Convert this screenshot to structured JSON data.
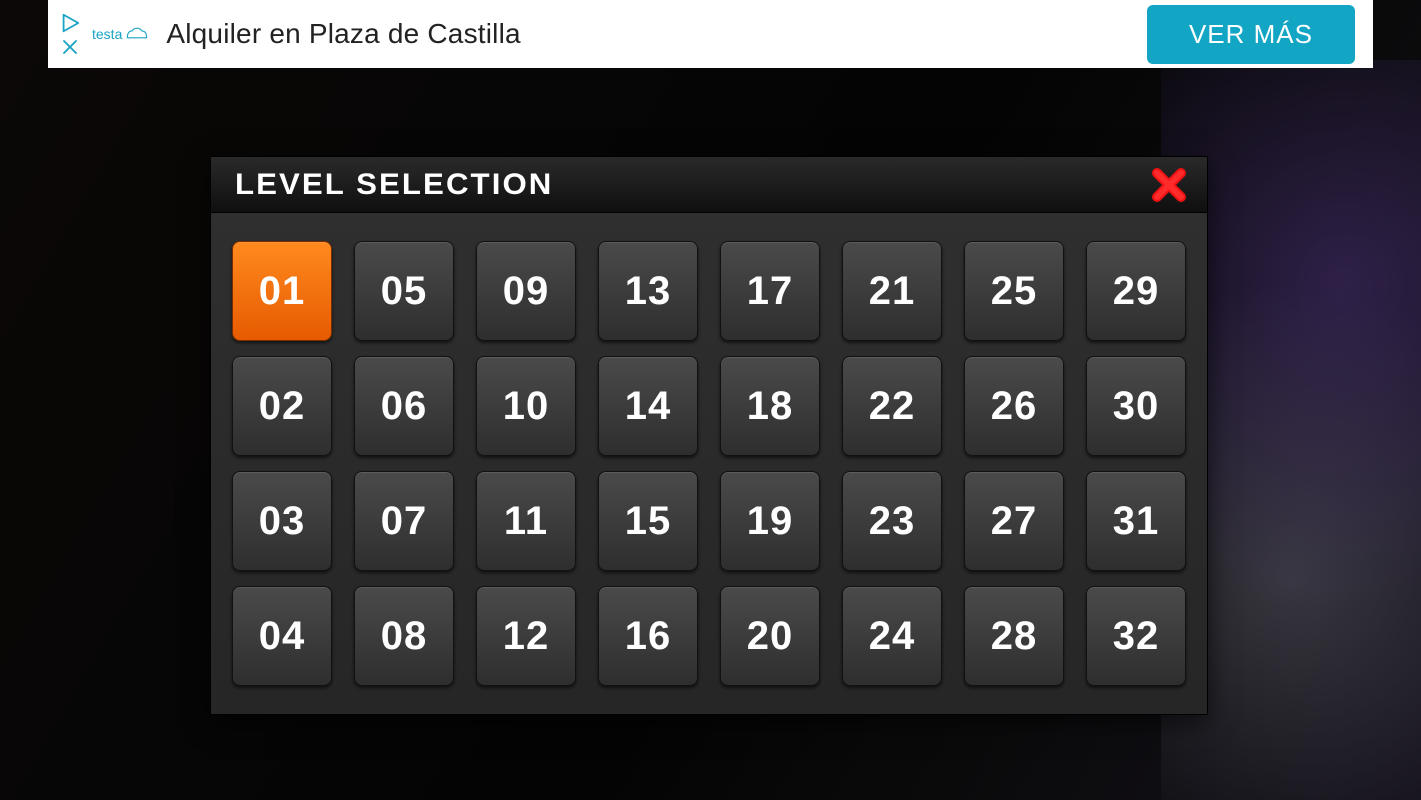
{
  "ad": {
    "brand": "testa",
    "headline": "Alquiler en Plaza de Castilla",
    "cta_label": "VER MÁS"
  },
  "panel": {
    "title": "LEVEL SELECTION",
    "selected_level": "01",
    "levels": [
      "01",
      "05",
      "09",
      "13",
      "17",
      "21",
      "25",
      "29",
      "02",
      "06",
      "10",
      "14",
      "18",
      "22",
      "26",
      "30",
      "03",
      "07",
      "11",
      "15",
      "19",
      "23",
      "27",
      "31",
      "04",
      "08",
      "12",
      "16",
      "20",
      "24",
      "28",
      "32"
    ]
  }
}
